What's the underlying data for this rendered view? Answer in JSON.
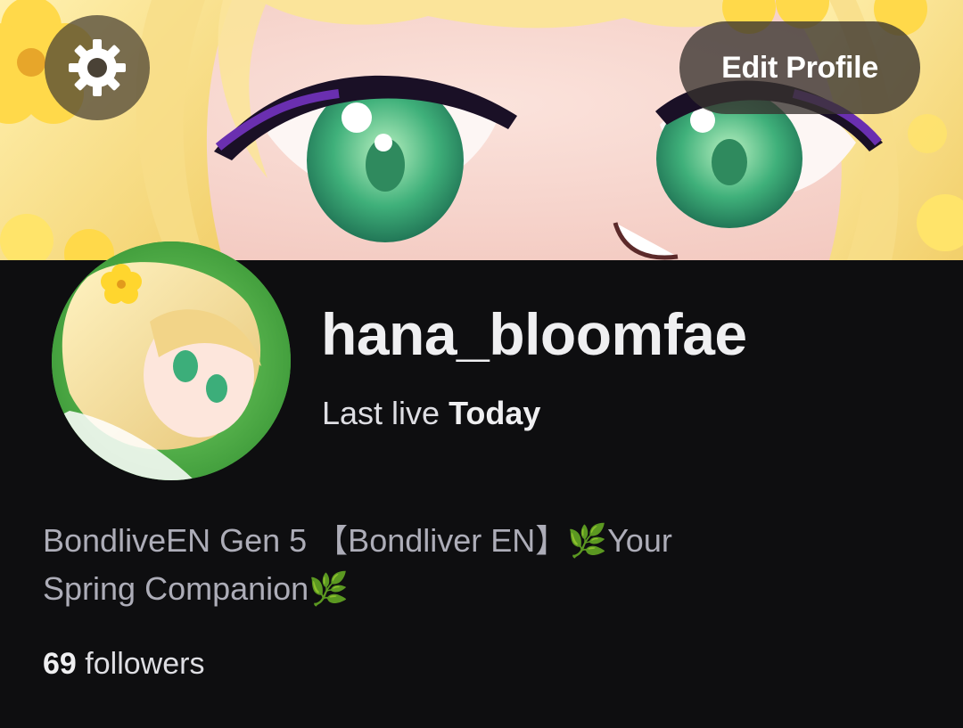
{
  "header": {
    "settings_icon": "gear-icon",
    "edit_profile_label": "Edit Profile"
  },
  "profile": {
    "username": "hana_bloomfae",
    "last_live_label": "Last live",
    "last_live_value": "Today",
    "bio_line_1": "BondliveEN Gen 5 【Bondliver EN】🌿Your",
    "bio_line_2": "Spring Companion🌿",
    "followers_count": "69",
    "followers_label": "followers"
  },
  "colors": {
    "background": "#0e0e10",
    "primary_text": "#efeff1",
    "secondary_text": "#adadb8"
  }
}
